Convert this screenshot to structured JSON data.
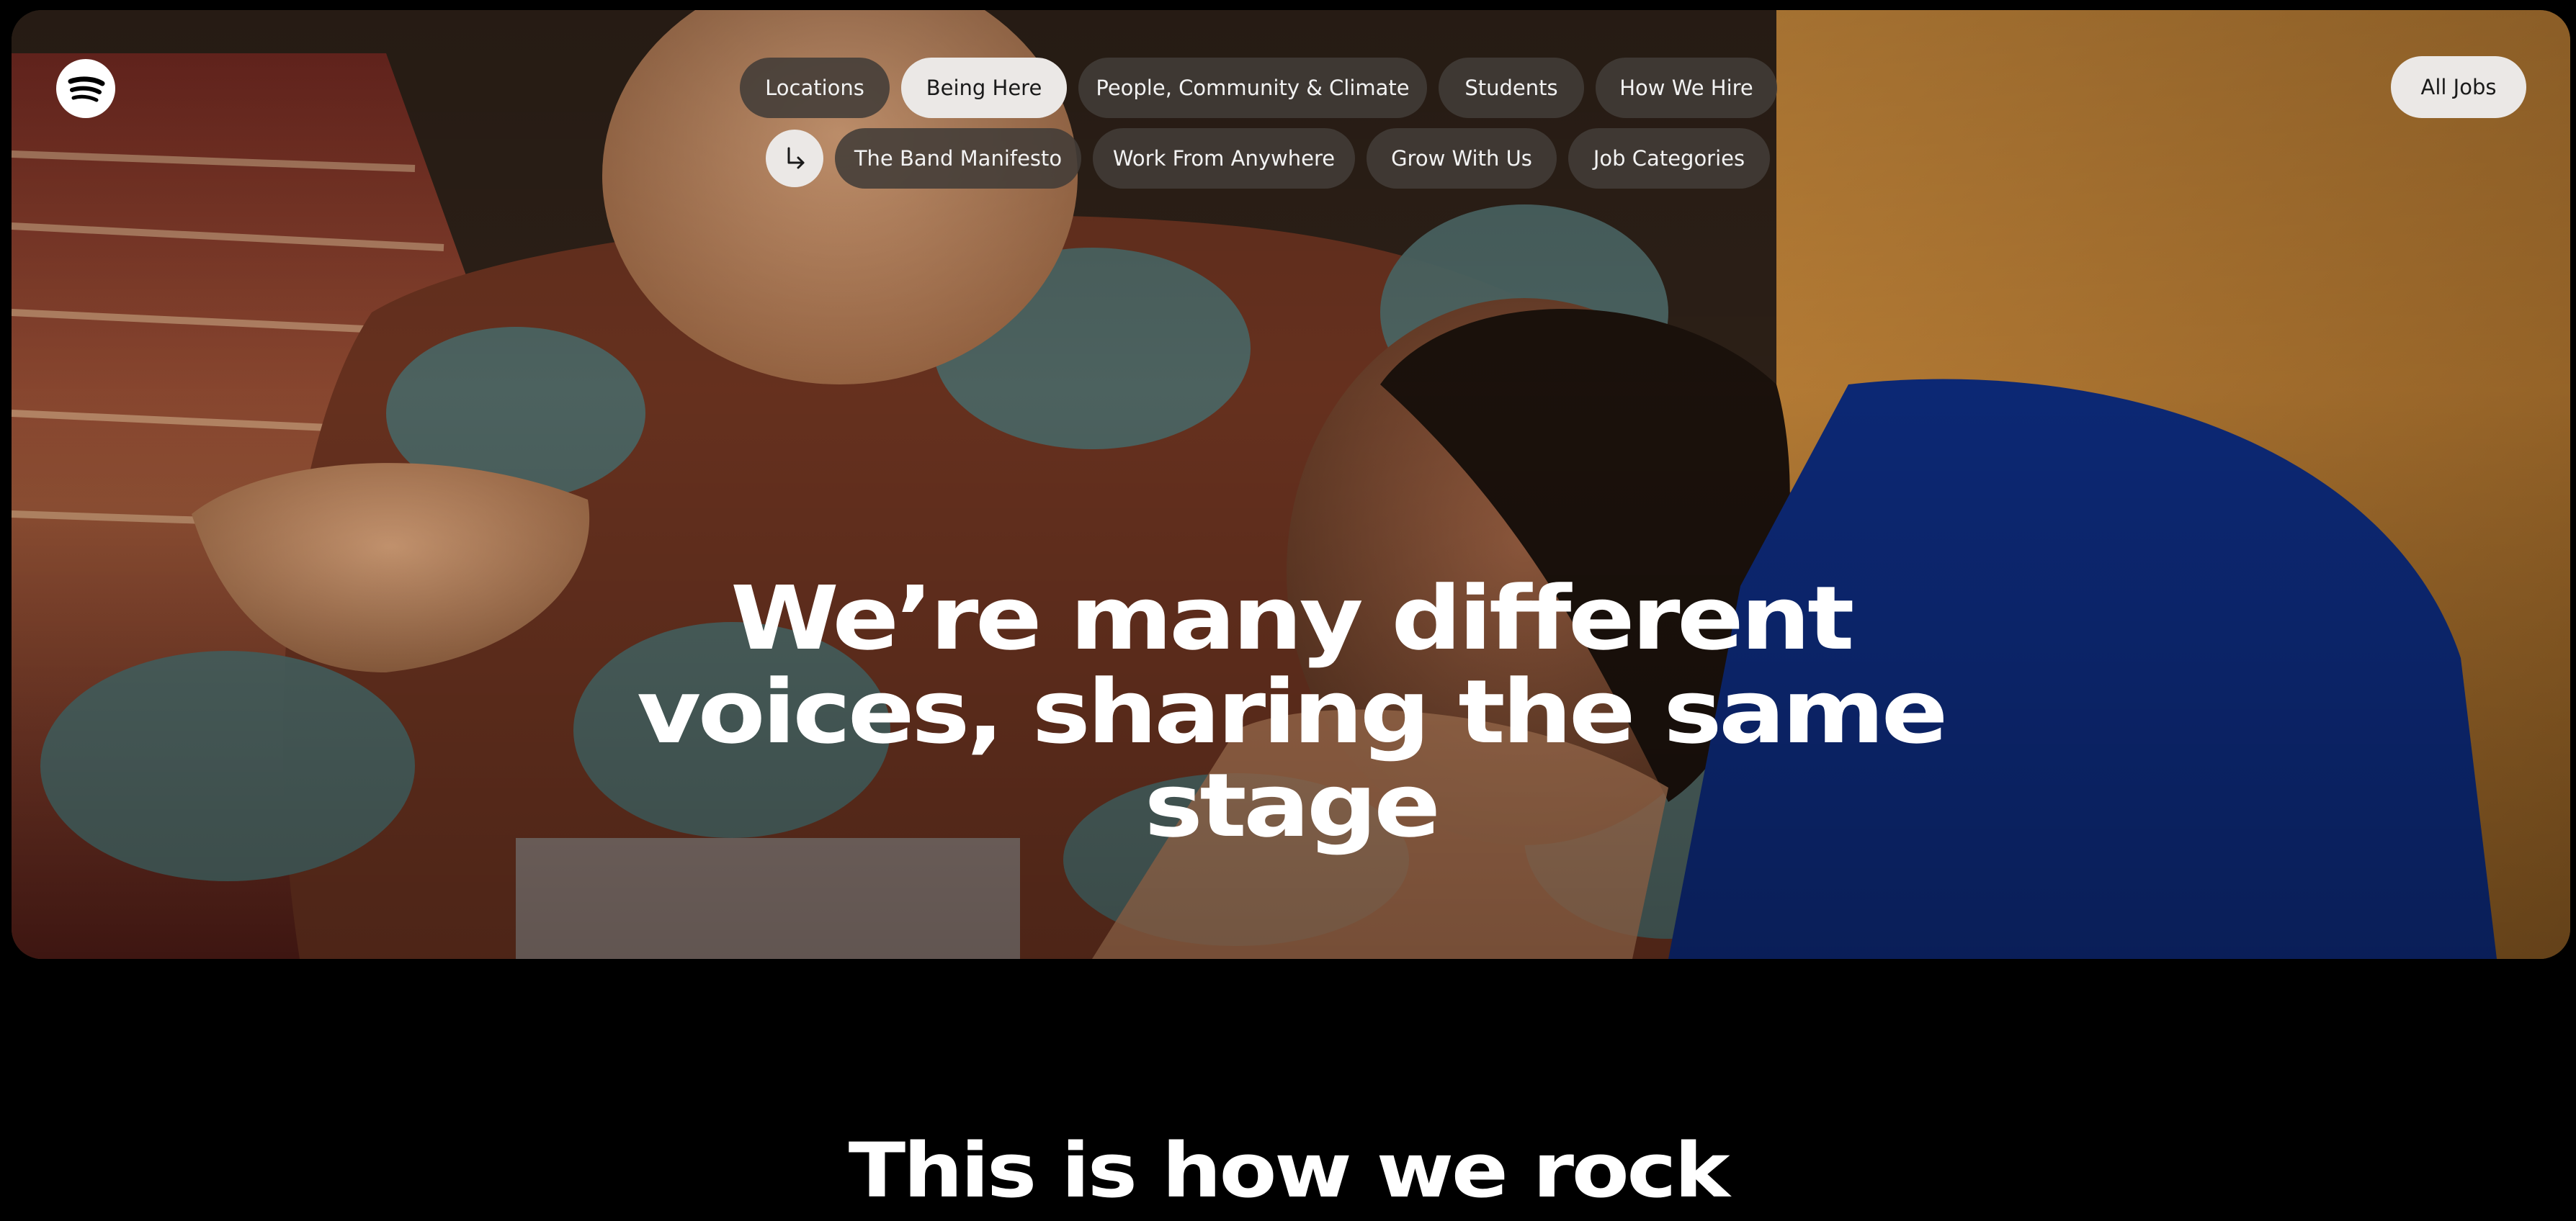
{
  "brand": {
    "name": "Spotify",
    "logo_icon": "spotify-logo-icon"
  },
  "nav": {
    "row1": [
      {
        "label": "Locations",
        "active": false
      },
      {
        "label": "Being Here",
        "active": true
      },
      {
        "label": "People, Community & Climate",
        "active": false
      },
      {
        "label": "Students",
        "active": false
      },
      {
        "label": "How We Hire",
        "active": false
      }
    ],
    "row2_icon": "arrow-down-right-icon",
    "row2": [
      {
        "label": "The Band Manifesto",
        "active": false
      },
      {
        "label": "Work From Anywhere",
        "active": false
      },
      {
        "label": "Grow With Us",
        "active": false
      },
      {
        "label": "Job Categories",
        "active": false
      }
    ],
    "all_jobs_label": "All Jobs"
  },
  "hero": {
    "headline_lines": [
      "We’re many different",
      "voices, sharing the same",
      "stage"
    ]
  },
  "section": {
    "title": "This is how we rock"
  },
  "colors": {
    "page_background": "#000000",
    "pill_background": "#423c38",
    "pill_active_background": "#ebe8e6",
    "text_primary": "#ffffff"
  }
}
